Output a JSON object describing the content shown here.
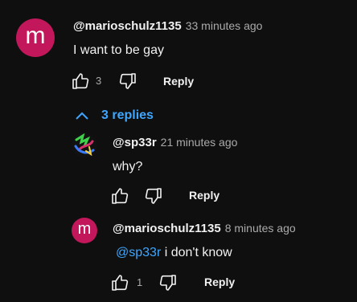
{
  "comment": {
    "avatar_letter": "m",
    "author": "@marioschulz1135",
    "time": "33 minutes ago",
    "text": "I want to be gay",
    "likes": "3",
    "reply_label": "Reply",
    "replies_toggle": "3 replies"
  },
  "replies": [
    {
      "author": "@sp33r",
      "time": "21 minutes ago",
      "text": "why?",
      "reply_label": "Reply"
    },
    {
      "avatar_letter": "m",
      "author": "@marioschulz1135",
      "time": "8 minutes ago",
      "mention": "@sp33r",
      "text": "i don't know",
      "likes": "1",
      "reply_label": "Reply"
    }
  ],
  "colors": {
    "background": "#0f0f0f",
    "avatar_pink": "#c2185b",
    "link_blue": "#3ea6ff"
  }
}
